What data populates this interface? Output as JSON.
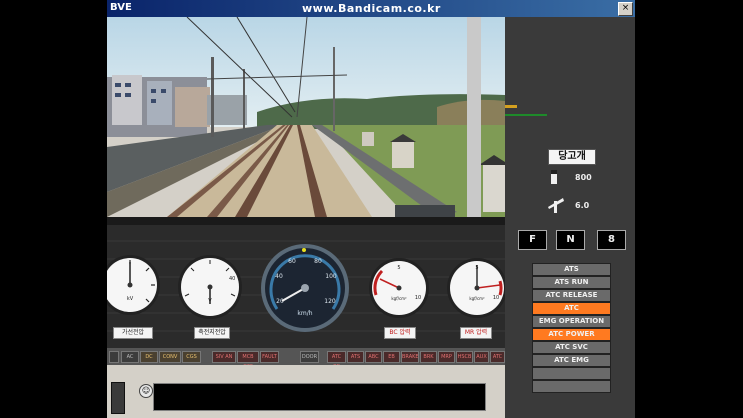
{
  "window": {
    "title": "BVE",
    "watermark": "www.Bandicam.co.kr",
    "close_glyph": "×"
  },
  "scene": {
    "description_colors": {
      "sky": "#cfe3ee",
      "grass": "#7f9b55",
      "ballast": "#c9b99a"
    }
  },
  "gauges": [
    {
      "id": "gauge-1",
      "unit": "kV",
      "sub": "가선전압",
      "value_deg": 0
    },
    {
      "id": "gauge-2",
      "unit": "V",
      "sub": "축전지전압",
      "label": "40",
      "value_deg": 90
    },
    {
      "id": "speedometer",
      "unit": "km/h",
      "ticks": [
        "20",
        "40",
        "60",
        "80",
        "100",
        "120"
      ]
    },
    {
      "id": "gauge-4",
      "unit": "kgf/cm²",
      "sub": "BC 압력",
      "ticks": [
        "5",
        "10"
      ]
    },
    {
      "id": "gauge-5",
      "unit": "kgf/cm²",
      "sub": "MR 압력",
      "ticks": [
        "5",
        "10"
      ]
    }
  ],
  "strip_buttons": [
    {
      "label": "AC",
      "state": "normal"
    },
    {
      "label": "DC",
      "state": "lit"
    },
    {
      "label": "CONV",
      "state": "lit"
    },
    {
      "label": "CGS",
      "state": "lit"
    },
    {
      "label": "SIV AN",
      "state": "red"
    },
    {
      "label": "MCB OFF",
      "state": "red"
    },
    {
      "label": "FAULT",
      "state": "red"
    },
    {
      "label": "DOOR",
      "state": "normal"
    },
    {
      "label": "ATC BP",
      "state": "red"
    },
    {
      "label": "ATS",
      "state": "red"
    },
    {
      "label": "ABC",
      "state": "red"
    },
    {
      "label": "EB",
      "state": "red"
    },
    {
      "label": "BRAKE",
      "state": "red"
    },
    {
      "label": "BRK",
      "state": "red"
    },
    {
      "label": "MRP",
      "state": "red"
    },
    {
      "label": "HSCB",
      "state": "red"
    },
    {
      "label": "AUX",
      "state": "red"
    },
    {
      "label": "ATC",
      "state": "red"
    }
  ],
  "side_panel": {
    "station": "당고개",
    "distance": "800",
    "gradient": "6.0",
    "reverser": [
      "F",
      "N",
      "8"
    ],
    "indicators": [
      {
        "label": "ATS",
        "on": false
      },
      {
        "label": "ATS RUN",
        "on": false
      },
      {
        "label": "ATC RELEASE",
        "on": false
      },
      {
        "label": "ATC",
        "on": true
      },
      {
        "label": "EMG OPERATION",
        "on": false
      },
      {
        "label": "ATC POWER",
        "on": true
      },
      {
        "label": "ATC SVC",
        "on": false
      },
      {
        "label": "ATC EMG",
        "on": false
      },
      {
        "label": "",
        "on": false
      },
      {
        "label": "",
        "on": false
      }
    ]
  },
  "colors": {
    "indicator_on": "#ff7a20",
    "indicator_off": "#6a6a6a"
  }
}
